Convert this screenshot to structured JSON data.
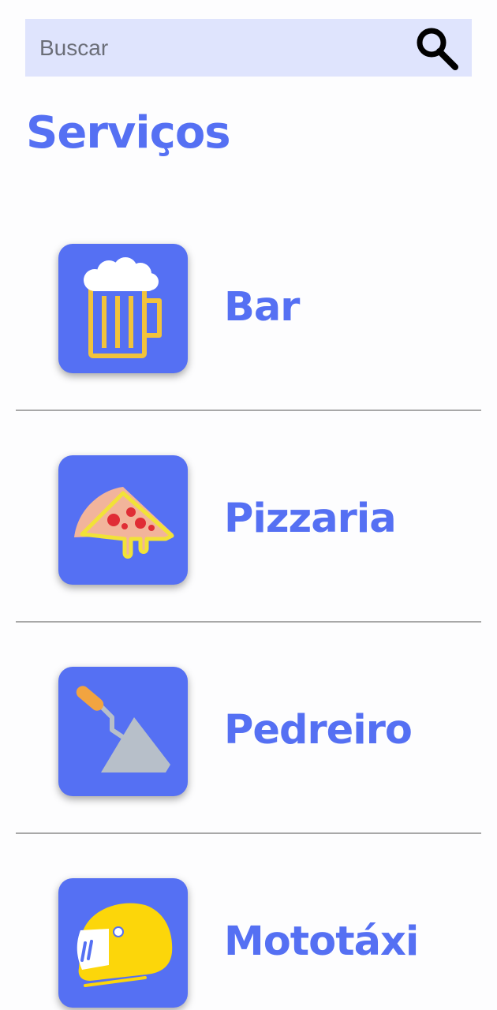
{
  "search": {
    "placeholder": "Buscar",
    "value": "",
    "icon": "search-icon"
  },
  "title": "Serviços",
  "colors": {
    "accent": "#5570f3",
    "search_background": "#dfe4fd",
    "divider": "#a8a8a8"
  },
  "services": [
    {
      "label": "Bar",
      "icon": "beer-mug-icon"
    },
    {
      "label": "Pizzaria",
      "icon": "pizza-slice-icon"
    },
    {
      "label": "Pedreiro",
      "icon": "trowel-icon"
    },
    {
      "label": "Mototáxi",
      "icon": "helmet-icon"
    }
  ]
}
